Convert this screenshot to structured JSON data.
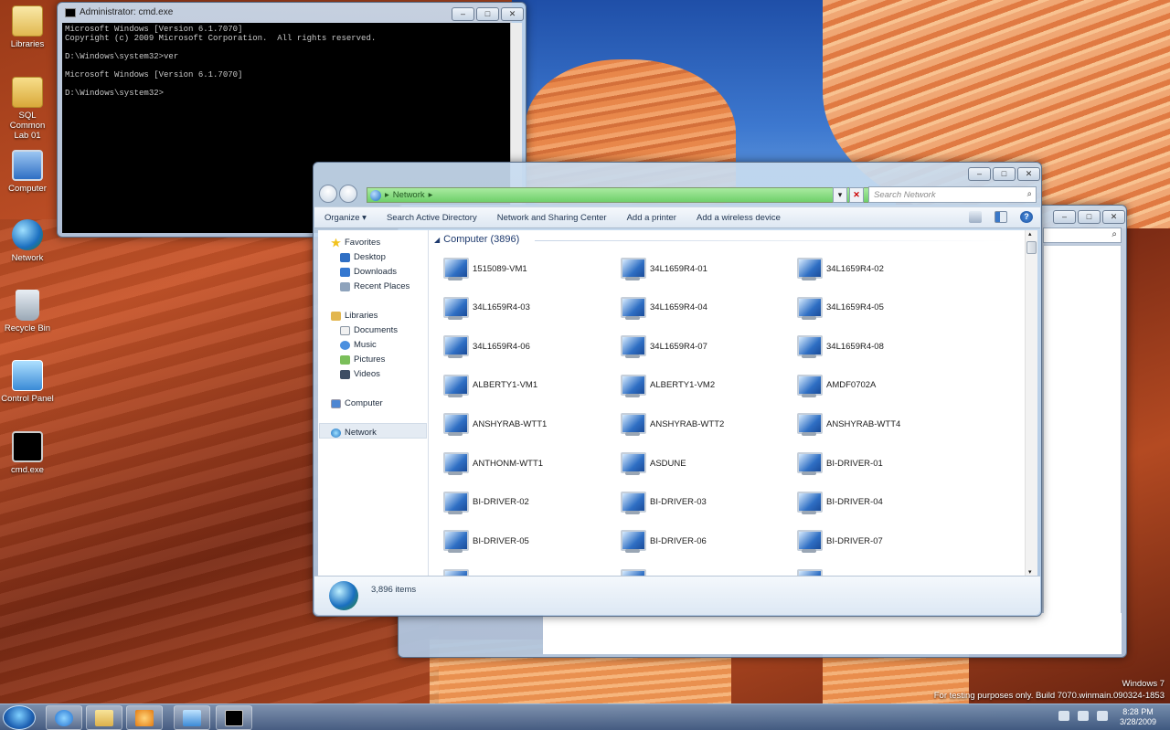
{
  "desktop": {
    "icons": [
      {
        "label": "Libraries",
        "icon": "libraries-icon"
      },
      {
        "label": "SQL Common Lab 01",
        "icon": "folder-icon"
      },
      {
        "label": "Computer",
        "icon": "computer-icon"
      },
      {
        "label": "Network",
        "icon": "network-icon"
      },
      {
        "label": "Recycle Bin",
        "icon": "recycle-bin-icon"
      },
      {
        "label": "Control Panel",
        "icon": "control-panel-icon"
      },
      {
        "label": "cmd.exe",
        "icon": "cmd-icon"
      }
    ],
    "watermark_edition": "Windows 7",
    "watermark_build": "For testing purposes only. Build 7070.winmain.090324-1853"
  },
  "cmd_window": {
    "title": "Administrator: cmd.exe",
    "lines": [
      "Microsoft Windows [Version 6.1.7070]",
      "Copyright (c) 2009 Microsoft Corporation.  All rights reserved.",
      "",
      "D:\\Windows\\system32>ver",
      "",
      "Microsoft Windows [Version 6.1.7070]",
      "",
      "D:\\Windows\\system32>"
    ]
  },
  "explorer": {
    "address": "Network",
    "search_placeholder": "Search Network",
    "toolbar": [
      "Organize ▾",
      "Search Active Directory",
      "Network and Sharing Center",
      "Add a printer",
      "Add a wireless device"
    ],
    "nav": {
      "favorites": "Favorites",
      "desktop": "Desktop",
      "downloads": "Downloads",
      "recent": "Recent Places",
      "libraries": "Libraries",
      "documents": "Documents",
      "music": "Music",
      "pictures": "Pictures",
      "videos": "Videos",
      "computer": "Computer",
      "network": "Network"
    },
    "group_label": "Computer (3896)",
    "computers": [
      "1515089-VM1",
      "34L1659R4-01",
      "34L1659R4-02",
      "34L1659R4-03",
      "34L1659R4-04",
      "34L1659R4-05",
      "34L1659R4-06",
      "34L1659R4-07",
      "34L1659R4-08",
      "ALBERTY1-VM1",
      "ALBERTY1-VM2",
      "AMDF0702A",
      "ANSHYRAB-WTT1",
      "ANSHYRAB-WTT2",
      "ANSHYRAB-WTT4",
      "ANTHONM-WTT1",
      "ASDUNE",
      "BI-DRIVER-01",
      "BI-DRIVER-02",
      "BI-DRIVER-03",
      "BI-DRIVER-04",
      "BI-DRIVER-05",
      "BI-DRIVER-06",
      "BI-DRIVER-07"
    ],
    "item_count": "3,896 items"
  },
  "taskbar": {
    "clock_time": "8:28 PM",
    "clock_date": "3/28/2009",
    "pinned": [
      "internet-explorer-icon",
      "windows-explorer-icon",
      "media-player-icon",
      "control-panel-icon",
      "cmd-icon"
    ]
  }
}
